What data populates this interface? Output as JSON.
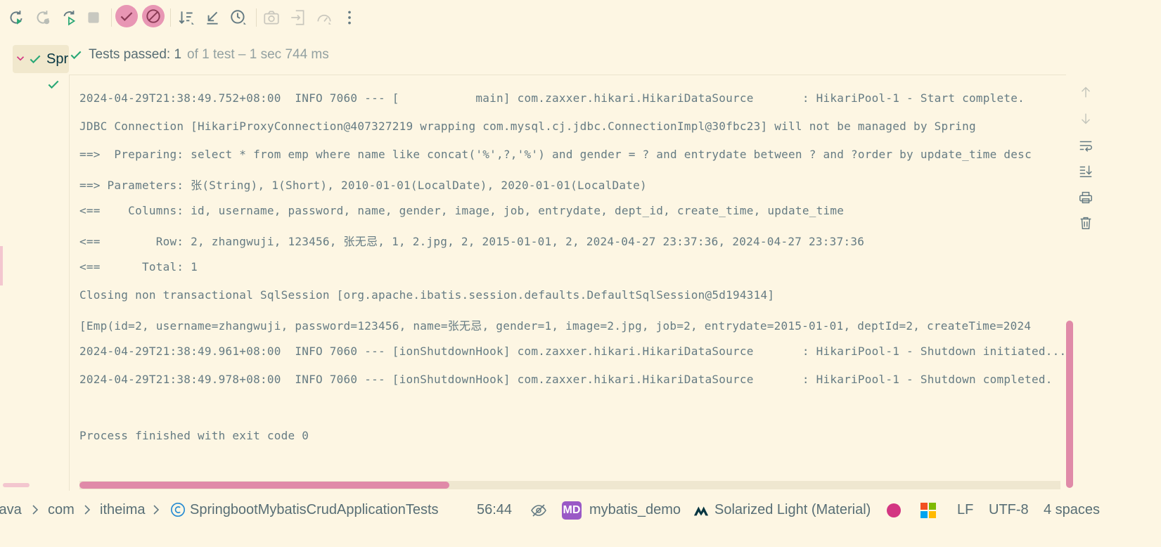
{
  "status": {
    "passed_label": "Tests passed: 1",
    "detail": "of 1 test – 1 sec 744 ms"
  },
  "tree": {
    "root_label": "Spr"
  },
  "console": {
    "lines": [
      "2024-04-29T21:38:49.752+08:00  INFO 7060 --- [           main] com.zaxxer.hikari.HikariDataSource       : HikariPool-1 - Start complete.",
      "JDBC Connection [HikariProxyConnection@407327219 wrapping com.mysql.cj.jdbc.ConnectionImpl@30fbc23] will not be managed by Spring",
      "==>  Preparing: select * from emp where name like concat('%',?,'%') and gender = ? and entrydate between ? and ?order by update_time desc",
      "==> Parameters: 张(String), 1(Short), 2010-01-01(LocalDate), 2020-01-01(LocalDate)",
      "<==    Columns: id, username, password, name, gender, image, job, entrydate, dept_id, create_time, update_time",
      "<==        Row: 2, zhangwuji, 123456, 张无忌, 1, 2.jpg, 2, 2015-01-01, 2, 2024-04-27 23:37:36, 2024-04-27 23:37:36",
      "<==      Total: 1",
      "Closing non transactional SqlSession [org.apache.ibatis.session.defaults.DefaultSqlSession@5d194314]",
      "[Emp(id=2, username=zhangwuji, password=123456, name=张无忌, gender=1, image=2.jpg, job=2, entrydate=2015-01-01, deptId=2, createTime=2024",
      "2024-04-29T21:38:49.961+08:00  INFO 7060 --- [ionShutdownHook] com.zaxxer.hikari.HikariDataSource       : HikariPool-1 - Shutdown initiated...",
      "2024-04-29T21:38:49.978+08:00  INFO 7060 --- [ionShutdownHook] com.zaxxer.hikari.HikariDataSource       : HikariPool-1 - Shutdown completed.",
      "",
      "Process finished with exit code 0"
    ]
  },
  "statusbar": {
    "crumb_1": "java",
    "crumb_2": "com",
    "crumb_3": "itheima",
    "crumb_4": "SpringbootMybatisCrudApplicationTests",
    "position": "56:44",
    "md_badge": "MD",
    "project": "mybatis_demo",
    "theme": "Solarized Light (Material)",
    "line_sep": "LF",
    "encoding": "UTF-8",
    "indent": "4 spaces"
  },
  "colors": {
    "background": "#fdf6e3",
    "accent_pink": "#e08aa8",
    "success_green": "#2aa876",
    "text": "#657b83"
  }
}
